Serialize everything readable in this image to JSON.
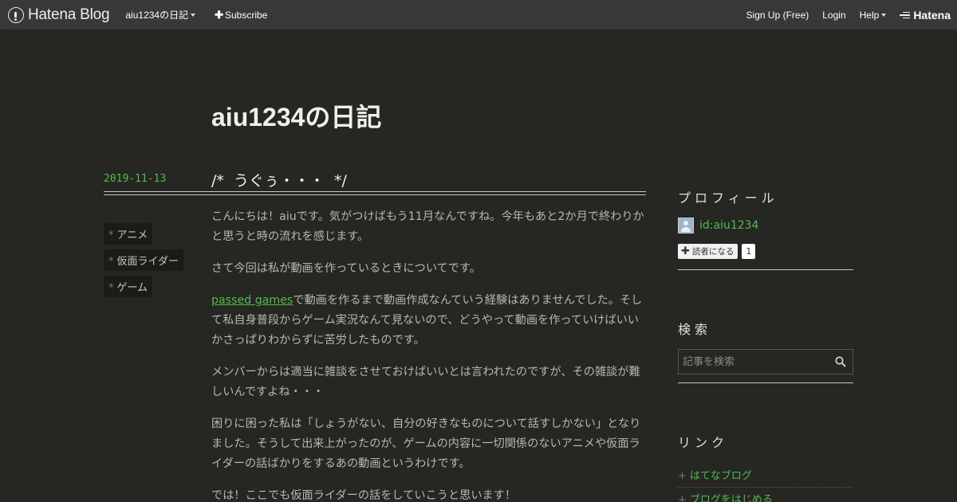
{
  "topbar": {
    "brand": "Hatena Blog",
    "blog_menu": "aiu1234の日記",
    "subscribe": "Subscribe",
    "signup": "Sign Up (Free)",
    "login": "Login",
    "help": "Help",
    "hatena": "Hatena"
  },
  "blog": {
    "title": "aiu1234の日記"
  },
  "entry": {
    "date": "2019-11-13",
    "title": "/*  うぐぅ・・・  */",
    "categories": [
      "アニメ",
      "仮面ライダー",
      "ゲーム"
    ],
    "paragraphs": [
      "こんにちは！aiuです。気がつけばもう11月なんですね。今年もあと2か月で終わりかと思うと時の流れを感じます。",
      "さて今回は私が動画を作っているときについてです。",
      "で動画を作るまで動画作成なんていう経験はありませんでした。そして私自身普段からゲーム実況なんて見ないので、どうやって動画を作っていけばいいかさっぱりわからずに苦労したものです。",
      " メンバーからは適当に雑談をさせておけばいいとは言われたのですが、その雑談が難しいんですよね・・・",
      "困りに困った私は「しょうがない、自分の好きなものについて話すしかない」となりました。そうして出来上がったのが、ゲームの内容に一切関係のないアニメや仮面ライダーの話ばかりをするあの動画というわけです。",
      "では！ここでも仮面ライダーの話をしていこうと思います！"
    ],
    "link_text": "passed games"
  },
  "sidebar": {
    "profile_heading": "プロフィール",
    "profile_id": "id:aiu1234",
    "reader_button": "読者になる",
    "reader_count": "1",
    "search_heading": "検索",
    "search_placeholder": "記事を検索",
    "links_heading": "リンク",
    "links": [
      "はてなブログ",
      "ブログをはじめる"
    ]
  },
  "colors": {
    "accent": "#4fbd4f",
    "background": "#262622",
    "topbar": "#383838"
  }
}
